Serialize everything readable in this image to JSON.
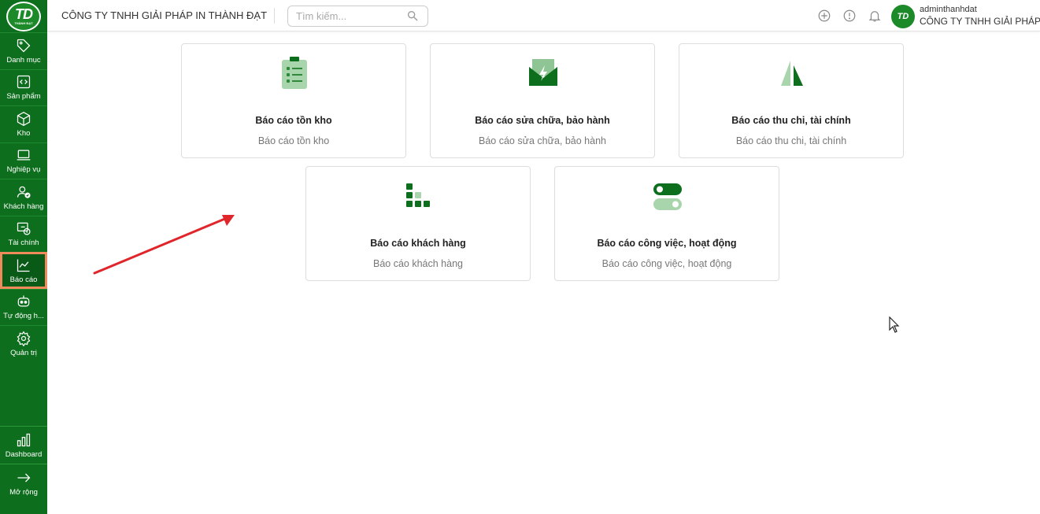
{
  "sidebar": {
    "logo_text": "TD",
    "logo_sub": "THÀNH ĐẠT",
    "items": [
      {
        "label": "Danh mục",
        "icon": "tag-icon"
      },
      {
        "label": "Sản phẩm",
        "icon": "code-icon"
      },
      {
        "label": "Kho",
        "icon": "box-icon"
      },
      {
        "label": "Nghiệp vụ",
        "icon": "laptop-icon"
      },
      {
        "label": "Khách hàng",
        "icon": "user-check-icon"
      },
      {
        "label": "Tài chính",
        "icon": "wallet-icon"
      },
      {
        "label": "Báo cáo",
        "icon": "chart-line-icon",
        "active": true
      },
      {
        "label": "Tự động h...",
        "icon": "robot-icon"
      },
      {
        "label": "Quản trị",
        "icon": "gear-icon"
      }
    ],
    "bottom_items": [
      {
        "label": "Dashboard",
        "icon": "bar-chart-icon"
      },
      {
        "label": "Mở rộng",
        "icon": "arrow-right-icon"
      }
    ]
  },
  "header": {
    "company": "CÔNG TY TNHH GIẢI PHÁP IN THÀNH ĐẠT",
    "search_placeholder": "Tìm kiếm...",
    "user_name": "adminthanhdat",
    "user_company": "CÔNG TY TNHH GIẢI PHÁP IN",
    "avatar_text": "TD"
  },
  "reports": [
    {
      "title": "Báo cáo tồn kho",
      "subtitle": "Báo cáo tồn kho",
      "icon": "clipboard-list-icon"
    },
    {
      "title": "Báo cáo sửa chữa, bảo hành",
      "subtitle": "Báo cáo sửa chữa, bảo hành",
      "icon": "repair-envelope-icon"
    },
    {
      "title": "Báo cáo thu chi, tài chính",
      "subtitle": "Báo cáo thu chi, tài chính",
      "icon": "finance-triangles-icon"
    },
    {
      "title": "Báo cáo khách hàng",
      "subtitle": "Báo cáo khách hàng",
      "icon": "customer-dots-icon"
    },
    {
      "title": "Báo cáo công việc, hoạt động",
      "subtitle": "Báo cáo công việc, hoạt động",
      "icon": "toggle-switches-icon"
    }
  ],
  "colors": {
    "brand_green": "#0d6e1d",
    "active_outline": "#ef8a5b",
    "arrow_red": "#e0262b"
  }
}
